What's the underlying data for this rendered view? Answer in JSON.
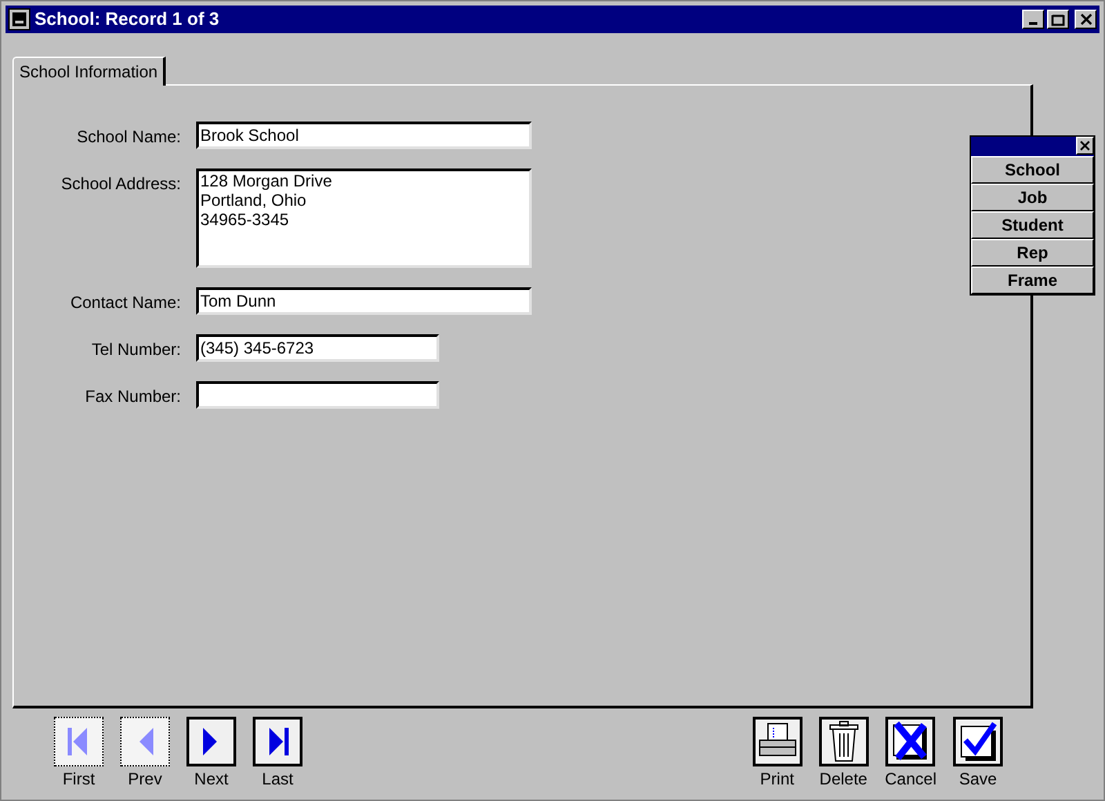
{
  "window": {
    "title": "School: Record 1 of 3"
  },
  "tabs": [
    {
      "label": "School Information",
      "selected": true
    }
  ],
  "fields": [
    {
      "label": "School Name:",
      "kind": "text",
      "value": "Brook School"
    },
    {
      "label": "School Address:",
      "kind": "multiline",
      "value": "128 Morgan Drive\nPortland, Ohio\n34965-3345"
    },
    {
      "label": "Contact Name:",
      "kind": "text",
      "value": "Tom Dunn"
    },
    {
      "label": "Tel Number:",
      "kind": "short-text",
      "value": "(345) 345-6723"
    },
    {
      "label": "Fax Number:",
      "kind": "short-text"
    }
  ],
  "palette": {
    "items": [
      "School",
      "Job",
      "Student",
      "Rep",
      "Frame"
    ]
  },
  "navigation": [
    {
      "label": "First",
      "kind": "first",
      "disabled": true
    },
    {
      "label": "Prev",
      "kind": "prev",
      "disabled": true
    },
    {
      "label": "Next",
      "kind": "next",
      "disabled": false
    },
    {
      "label": "Last",
      "kind": "last",
      "disabled": false
    }
  ],
  "actions": [
    {
      "label": "Print",
      "kind": "print"
    },
    {
      "label": "Delete",
      "kind": "delete"
    },
    {
      "label": "Cancel",
      "kind": "cancel"
    },
    {
      "label": "Save",
      "kind": "save"
    }
  ]
}
